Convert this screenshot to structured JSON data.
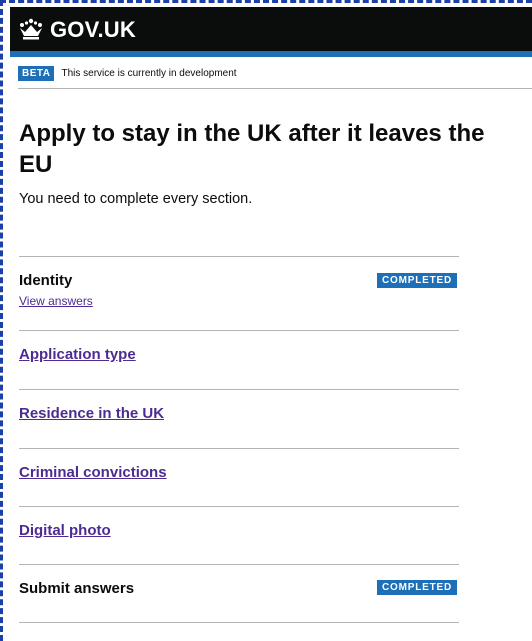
{
  "header": {
    "logo_text": "GOV.UK",
    "crown_icon": "crown-icon"
  },
  "phase_banner": {
    "tag": "BETA",
    "text": "This service is currently in development"
  },
  "main": {
    "title": "Apply to stay in the UK after it leaves the EU",
    "intro": "You need to complete every section."
  },
  "tasks": [
    {
      "label": "Identity",
      "link": "View answers",
      "status": "COMPLETED"
    },
    {
      "label": "Application type"
    },
    {
      "label": "Residence in the UK"
    },
    {
      "label": "Criminal convictions"
    },
    {
      "label": "Digital photo"
    },
    {
      "label": "Submit answers",
      "status": "COMPLETED"
    }
  ],
  "colors": {
    "header": "#0b0c0c",
    "accent": "#1d70b8",
    "link": "#4c2c92"
  }
}
